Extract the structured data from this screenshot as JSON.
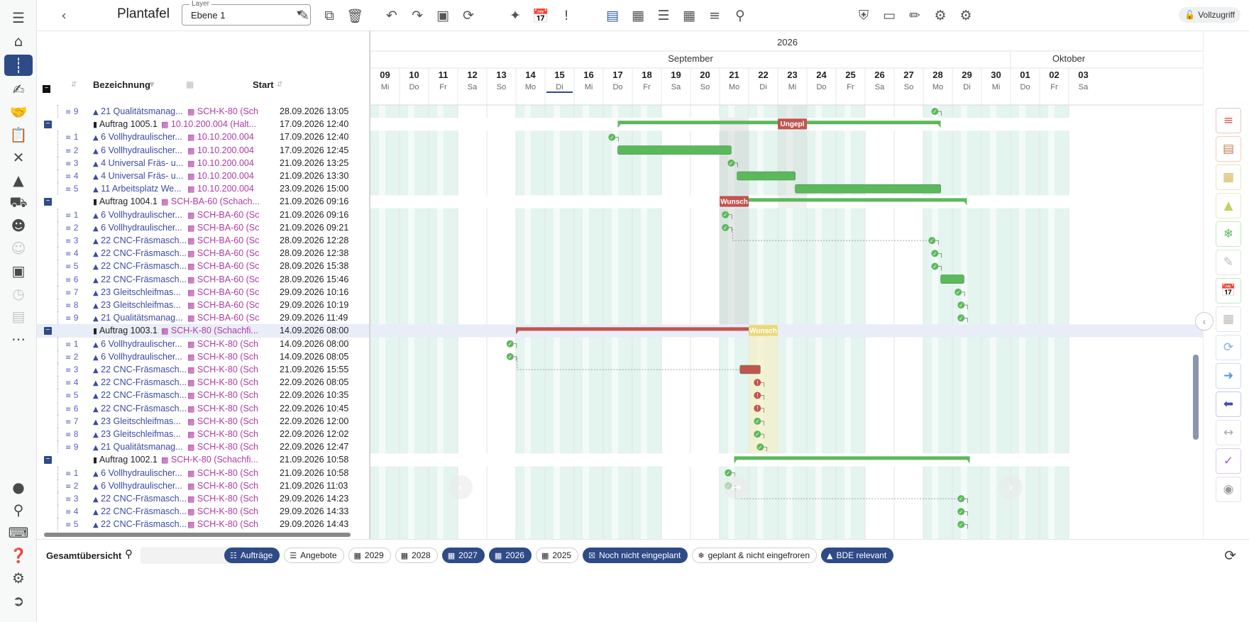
{
  "app": {
    "title": "Plantafel",
    "layer_label": "Layer",
    "layer_value": "Ebene 1",
    "access_label": "Vollzugriff"
  },
  "grid": {
    "columns": {
      "name": "Bezeichnung",
      "start": "Start"
    },
    "rows": [
      {
        "kind": "op",
        "num": "9",
        "name": "21 Qualitätsmanag...",
        "res": "SCH-K-80 (Sch",
        "start": "28.09.2026 13:05"
      },
      {
        "kind": "order",
        "name": "Auftrag 1005.1",
        "res": "10.10.200.004 (Halt...",
        "start": "17.09.2026 12:40"
      },
      {
        "kind": "op",
        "num": "1",
        "name": "6 Vollhydraulischer...",
        "res": "10.10.200.004",
        "start": "17.09.2026 12:40"
      },
      {
        "kind": "op",
        "num": "2",
        "name": "6 Vollhydraulischer...",
        "res": "10.10.200.004",
        "start": "17.09.2026 12:45"
      },
      {
        "kind": "op",
        "num": "3",
        "name": "4 Universal Fräs- u...",
        "res": "10.10.200.004",
        "start": "21.09.2026 13:25"
      },
      {
        "kind": "op",
        "num": "4",
        "name": "4 Universal Fräs- u...",
        "res": "10.10.200.004",
        "start": "21.09.2026 13:30"
      },
      {
        "kind": "op",
        "num": "5",
        "name": "11 Arbeitsplatz We...",
        "res": "10.10.200.004",
        "start": "23.09.2026 15:00"
      },
      {
        "kind": "order",
        "name": "Auftrag 1004.1",
        "res": "SCH-BA-60 (Schach...",
        "start": "21.09.2026 09:16"
      },
      {
        "kind": "op",
        "num": "1",
        "name": "6 Vollhydraulischer...",
        "res": "SCH-BA-60 (Sc",
        "start": "21.09.2026 09:16"
      },
      {
        "kind": "op",
        "num": "2",
        "name": "6 Vollhydraulischer...",
        "res": "SCH-BA-60 (Sc",
        "start": "21.09.2026 09:21"
      },
      {
        "kind": "op",
        "num": "3",
        "name": "22 CNC-Fräsmasch...",
        "res": "SCH-BA-60 (Sc",
        "start": "28.09.2026 12:28"
      },
      {
        "kind": "op",
        "num": "4",
        "name": "22 CNC-Fräsmasch...",
        "res": "SCH-BA-60 (Sc",
        "start": "28.09.2026 12:38"
      },
      {
        "kind": "op",
        "num": "5",
        "name": "22 CNC-Fräsmasch...",
        "res": "SCH-BA-60 (Sc",
        "start": "28.09.2026 15:38"
      },
      {
        "kind": "op",
        "num": "6",
        "name": "22 CNC-Fräsmasch...",
        "res": "SCH-BA-60 (Sc",
        "start": "28.09.2026 15:46"
      },
      {
        "kind": "op",
        "num": "7",
        "name": "23 Gleitschleifmas...",
        "res": "SCH-BA-60 (Sc",
        "start": "29.09.2026 10:16"
      },
      {
        "kind": "op",
        "num": "8",
        "name": "23 Gleitschleifmas...",
        "res": "SCH-BA-60 (Sc",
        "start": "29.09.2026 10:19"
      },
      {
        "kind": "op",
        "num": "9",
        "name": "21 Qualitätsmanag...",
        "res": "SCH-BA-60 (Sc",
        "start": "29.09.2026 11:49"
      },
      {
        "kind": "order",
        "name": "Auftrag 1003.1",
        "res": "SCH-K-80 (Schachfi...",
        "start": "14.09.2026 08:00"
      },
      {
        "kind": "op",
        "num": "1",
        "name": "6 Vollhydraulischer...",
        "res": "SCH-K-80 (Sch",
        "start": "14.09.2026 08:00"
      },
      {
        "kind": "op",
        "num": "2",
        "name": "6 Vollhydraulischer...",
        "res": "SCH-K-80 (Sch",
        "start": "14.09.2026 08:05"
      },
      {
        "kind": "op",
        "num": "3",
        "name": "22 CNC-Fräsmasch...",
        "res": "SCH-K-80 (Sch",
        "start": "21.09.2026 15:55"
      },
      {
        "kind": "op",
        "num": "4",
        "name": "22 CNC-Fräsmasch...",
        "res": "SCH-K-80 (Sch",
        "start": "22.09.2026 08:05"
      },
      {
        "kind": "op",
        "num": "5",
        "name": "22 CNC-Fräsmasch...",
        "res": "SCH-K-80 (Sch",
        "start": "22.09.2026 10:35"
      },
      {
        "kind": "op",
        "num": "6",
        "name": "22 CNC-Fräsmasch...",
        "res": "SCH-K-80 (Sch",
        "start": "22.09.2026 10:45"
      },
      {
        "kind": "op",
        "num": "7",
        "name": "23 Gleitschleifmas...",
        "res": "SCH-K-80 (Sch",
        "start": "22.09.2026 12:00"
      },
      {
        "kind": "op",
        "num": "8",
        "name": "23 Gleitschleifmas...",
        "res": "SCH-K-80 (Sch",
        "start": "22.09.2026 12:02"
      },
      {
        "kind": "op",
        "num": "9",
        "name": "21 Qualitätsmanag...",
        "res": "SCH-K-80 (Sch",
        "start": "22.09.2026 12:47"
      },
      {
        "kind": "order",
        "name": "Auftrag 1002.1",
        "res": "SCH-K-80 (Schachfi...",
        "start": "21.09.2026 10:58"
      },
      {
        "kind": "op",
        "num": "1",
        "name": "6 Vollhydraulischer...",
        "res": "SCH-K-80 (Sch",
        "start": "21.09.2026 10:58"
      },
      {
        "kind": "op",
        "num": "2",
        "name": "6 Vollhydraulischer...",
        "res": "SCH-K-80 (Sch",
        "start": "21.09.2026 11:03"
      },
      {
        "kind": "op",
        "num": "3",
        "name": "22 CNC-Fräsmasch...",
        "res": "SCH-K-80 (Sch",
        "start": "29.09.2026 14:23"
      },
      {
        "kind": "op",
        "num": "4",
        "name": "22 CNC-Fräsmasch...",
        "res": "SCH-K-80 (Sch",
        "start": "29.09.2026 14:33"
      },
      {
        "kind": "op",
        "num": "5",
        "name": "22 CNC-Fräsmasch...",
        "res": "SCH-K-80 (Sch",
        "start": "29.09.2026 14:43"
      }
    ]
  },
  "timeline": {
    "year": "2026",
    "months": [
      {
        "name": "September",
        "first": 0,
        "last": 21
      },
      {
        "name": "Oktober",
        "first": 22,
        "last": 24
      }
    ],
    "days": [
      {
        "d": "09",
        "w": "Mi"
      },
      {
        "d": "10",
        "w": "Do"
      },
      {
        "d": "11",
        "w": "Fr"
      },
      {
        "d": "12",
        "w": "Sa"
      },
      {
        "d": "13",
        "w": "So"
      },
      {
        "d": "14",
        "w": "Mo"
      },
      {
        "d": "15",
        "w": "Di"
      },
      {
        "d": "16",
        "w": "Mi"
      },
      {
        "d": "17",
        "w": "Do"
      },
      {
        "d": "18",
        "w": "Fr"
      },
      {
        "d": "19",
        "w": "Sa"
      },
      {
        "d": "20",
        "w": "So"
      },
      {
        "d": "21",
        "w": "Mo"
      },
      {
        "d": "22",
        "w": "Di"
      },
      {
        "d": "23",
        "w": "Mi"
      },
      {
        "d": "24",
        "w": "Do"
      },
      {
        "d": "25",
        "w": "Fr"
      },
      {
        "d": "26",
        "w": "Sa"
      },
      {
        "d": "27",
        "w": "So"
      },
      {
        "d": "28",
        "w": "Mo"
      },
      {
        "d": "29",
        "w": "Di"
      },
      {
        "d": "30",
        "w": "Mi"
      },
      {
        "d": "01",
        "w": "Do"
      },
      {
        "d": "02",
        "w": "Fr"
      },
      {
        "d": "03",
        "w": "Sa"
      }
    ],
    "today_index": 6,
    "bars": [
      {
        "row": 1,
        "from": 8.5,
        "to": 19.6,
        "color": "green",
        "summary": true
      },
      {
        "row": 1,
        "from": 14.0,
        "to": 15.0,
        "color": "red",
        "label": "Ungeplant"
      },
      {
        "row": 3,
        "from": 8.5,
        "to": 12.4,
        "color": "green"
      },
      {
        "row": 5,
        "from": 12.6,
        "to": 14.6,
        "color": "green"
      },
      {
        "row": 6,
        "from": 14.6,
        "to": 19.6,
        "color": "green"
      },
      {
        "row": 7,
        "from": 12.4,
        "to": 20.5,
        "color": "green",
        "summary": true
      },
      {
        "row": 7,
        "from": 12.0,
        "to": 13.0,
        "color": "red",
        "label": "Wunschtermin"
      },
      {
        "row": 13,
        "from": 19.6,
        "to": 20.4,
        "color": "green"
      },
      {
        "row": 17,
        "from": 5.0,
        "to": 13.9,
        "color": "red",
        "summary": true
      },
      {
        "row": 17,
        "from": 13.0,
        "to": 14.0,
        "color": "yellow",
        "label": "Wunschtermin"
      },
      {
        "row": 20,
        "from": 12.7,
        "to": 13.4,
        "color": "red"
      },
      {
        "row": 27,
        "from": 12.5,
        "to": 20.6,
        "color": "green",
        "summary": true
      }
    ],
    "markers": [
      {
        "row": 0,
        "at": 19.4,
        "s": "ok"
      },
      {
        "row": 2,
        "at": 8.3,
        "s": "ok"
      },
      {
        "row": 4,
        "at": 12.4,
        "s": "ok"
      },
      {
        "row": 8,
        "at": 12.2,
        "s": "ok"
      },
      {
        "row": 9,
        "at": 12.2,
        "s": "ok"
      },
      {
        "row": 10,
        "at": 19.3,
        "s": "ok"
      },
      {
        "row": 11,
        "at": 19.4,
        "s": "ok"
      },
      {
        "row": 12,
        "at": 19.4,
        "s": "ok"
      },
      {
        "row": 14,
        "at": 20.2,
        "s": "ok"
      },
      {
        "row": 15,
        "at": 20.3,
        "s": "ok"
      },
      {
        "row": 16,
        "at": 20.3,
        "s": "ok"
      },
      {
        "row": 18,
        "at": 4.8,
        "s": "ok"
      },
      {
        "row": 19,
        "at": 4.8,
        "s": "ok"
      },
      {
        "row": 21,
        "at": 13.3,
        "s": "late"
      },
      {
        "row": 22,
        "at": 13.3,
        "s": "late"
      },
      {
        "row": 23,
        "at": 13.3,
        "s": "late"
      },
      {
        "row": 24,
        "at": 13.3,
        "s": "ok"
      },
      {
        "row": 25,
        "at": 13.3,
        "s": "ok"
      },
      {
        "row": 26,
        "at": 13.4,
        "s": "ok"
      },
      {
        "row": 28,
        "at": 12.3,
        "s": "ok"
      },
      {
        "row": 29,
        "at": 12.3,
        "s": "ok"
      },
      {
        "row": 30,
        "at": 20.3,
        "s": "ok"
      },
      {
        "row": 31,
        "at": 20.3,
        "s": "ok"
      },
      {
        "row": 32,
        "at": 20.3,
        "s": "ok"
      }
    ]
  },
  "filters": {
    "overview": "Gesamtübersicht",
    "chips": [
      {
        "label": "Aufträge",
        "on": true,
        "icon": "clipboard-icon"
      },
      {
        "label": "Angebote",
        "on": false,
        "icon": "document-icon"
      },
      {
        "label": "2029",
        "on": false,
        "icon": "calendar-icon"
      },
      {
        "label": "2028",
        "on": false,
        "icon": "calendar-icon"
      },
      {
        "label": "2027",
        "on": true,
        "icon": "calendar-icon"
      },
      {
        "label": "2026",
        "on": true,
        "icon": "calendar-icon"
      },
      {
        "label": "2025",
        "on": false,
        "icon": "calendar-icon"
      },
      {
        "label": "Noch nicht eingeplant",
        "on": true,
        "icon": "calendar-x-icon"
      },
      {
        "label": "geplant & nicht eingefroren",
        "on": false,
        "icon": "snowflake-icon"
      },
      {
        "label": "BDE relevant",
        "on": true,
        "icon": "factory-icon"
      }
    ]
  },
  "colors": {
    "accent": "#2e4a87",
    "green": "#5cb85c",
    "red": "#c0554f",
    "yellow": "#efe39a",
    "workday": "#e4f4ef"
  }
}
